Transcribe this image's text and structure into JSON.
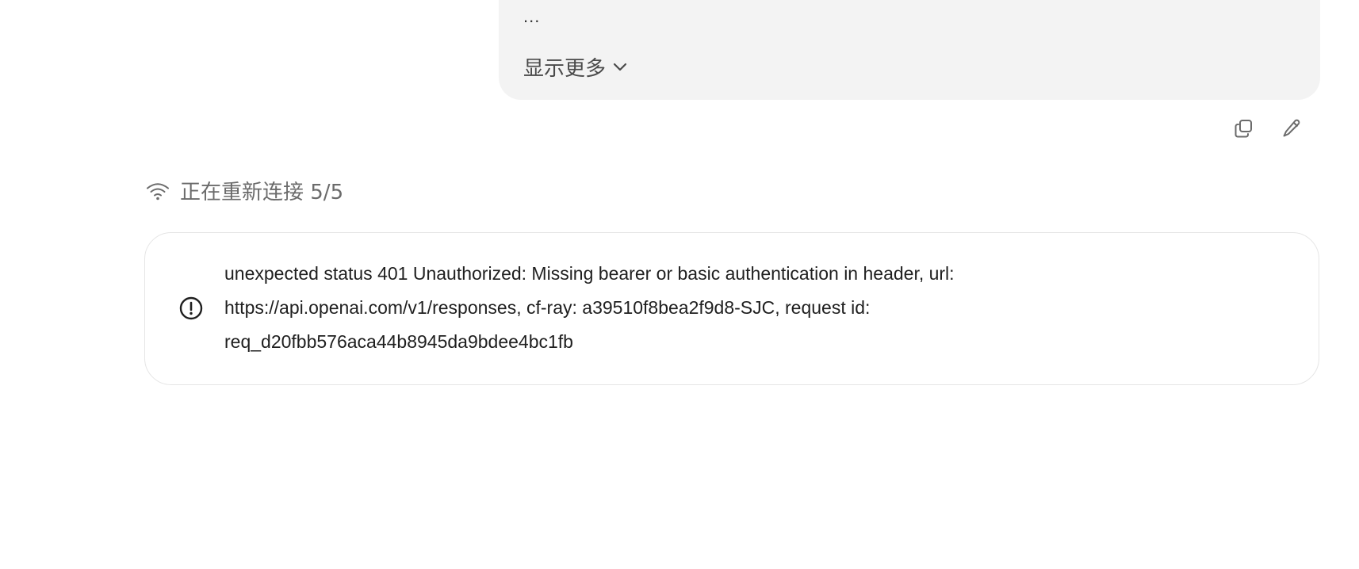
{
  "user_message": {
    "clipped_line": "...",
    "ellipsis": "...",
    "show_more_label": "显示更多"
  },
  "message_actions": {
    "copy_icon": "copy-icon",
    "edit_icon": "edit-pencil-icon"
  },
  "status": {
    "icon": "wifi-icon",
    "label": "正在重新连接 5/5"
  },
  "error": {
    "icon": "alert-circle-icon",
    "lines": [
      "unexpected status 401 Unauthorized: Missing bearer or basic authentication in header, url:",
      "https://api.openai.com/v1/responses, cf-ray: a39510f8bea2f9d8-SJC, request id:",
      "req_d20fbb576aca44b8945da9bdee4bc1fb"
    ]
  },
  "colors": {
    "bubble_bg": "#f3f3f3",
    "muted_text": "#6b6b6b",
    "card_border": "#e5e5e5"
  }
}
